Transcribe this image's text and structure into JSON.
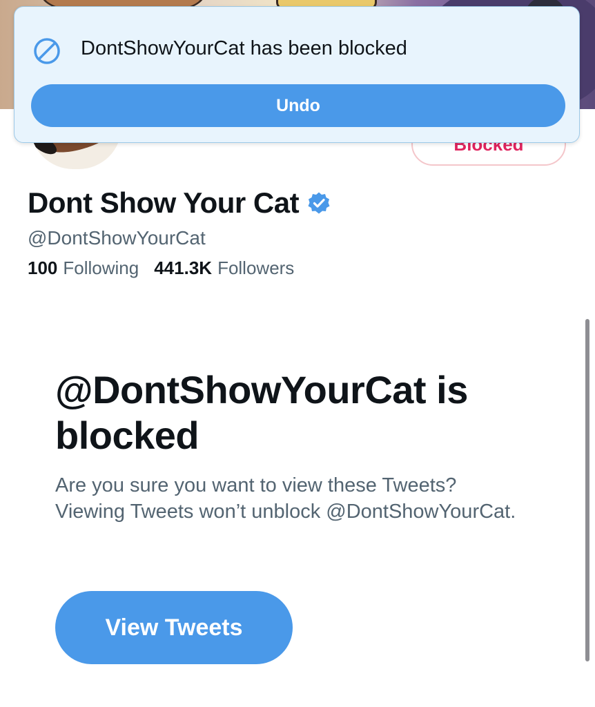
{
  "toast": {
    "message": "DontShowYourCat has been blocked",
    "undo_label": "Undo",
    "icon": "block-icon"
  },
  "profile": {
    "display_name": "Dont Show Your Cat",
    "verified_icon": "verified-badge-icon",
    "handle": "@DontShowYourCat",
    "following_count": "100",
    "following_label": "Following",
    "followers_count": "441.3K",
    "followers_label": "Followers",
    "blocked_button_label": "Blocked"
  },
  "blocked_notice": {
    "title": "@DontShowYourCat is blocked",
    "description": "Are you sure you want to view these Tweets? Viewing Tweets won’t unblock @DontShowYourCat.",
    "view_button_label": "View Tweets"
  },
  "colors": {
    "accent": "#4a99e9",
    "blocked_red": "#e0245e",
    "secondary_text": "#536471",
    "toast_bg": "#e8f4fd"
  }
}
